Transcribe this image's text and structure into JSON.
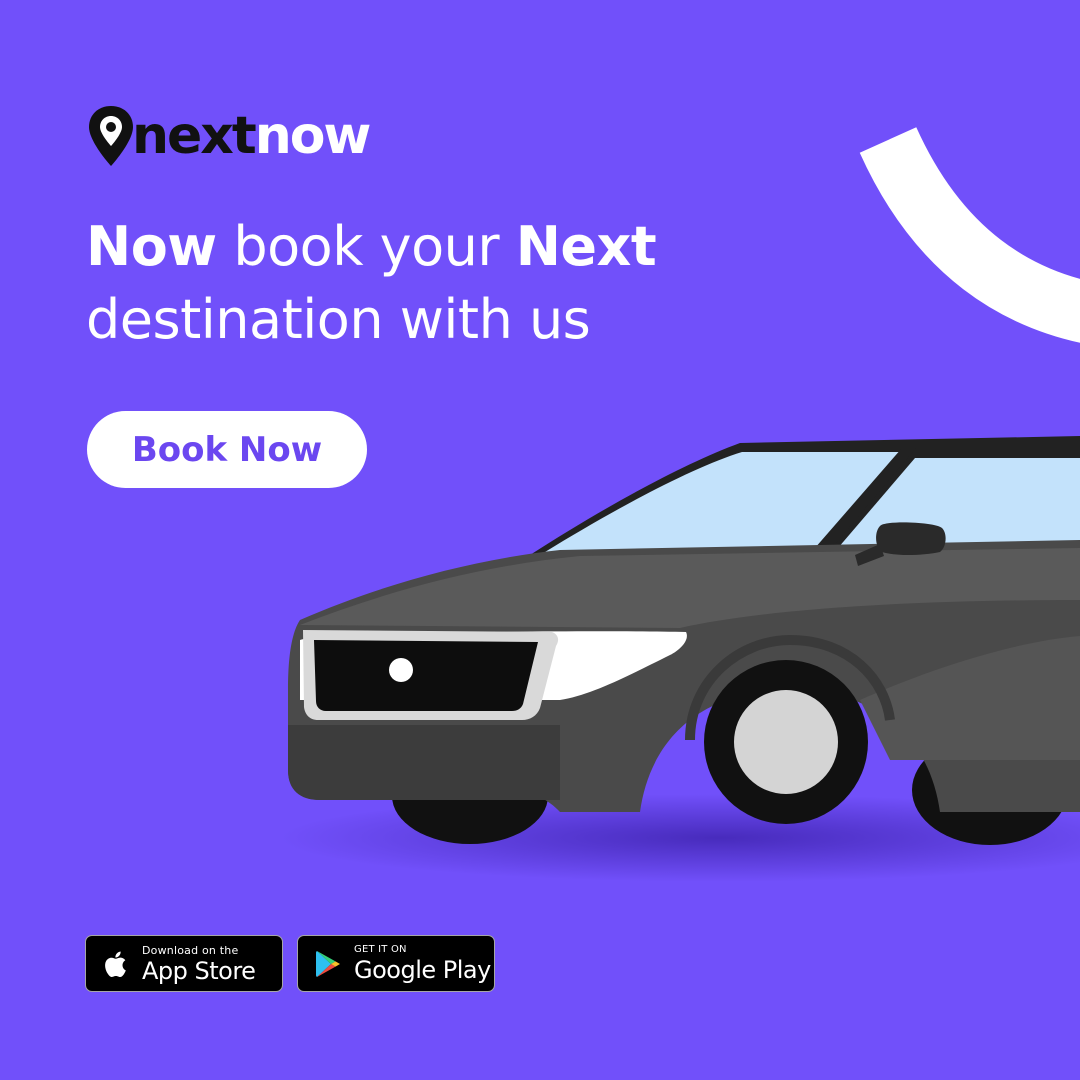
{
  "brand": {
    "logo_part1": "next",
    "logo_part2": "now"
  },
  "headline": {
    "line1_bold_a": "Now",
    "line1_regular": " book your ",
    "line1_bold_b": "Next",
    "line2": "destination with us"
  },
  "cta": {
    "label": "Book Now"
  },
  "badges": {
    "apple": {
      "small": "Download on the",
      "big": "App Store",
      "icon": "apple-icon"
    },
    "google": {
      "small": "GET IT ON",
      "big": "Google Play",
      "icon": "google-play-icon"
    }
  },
  "colors": {
    "background": "#7150fa",
    "accent_text": "#6b47f0",
    "white": "#ffffff",
    "car_body": "#4a4a4a",
    "windshield": "#c3e2fb"
  }
}
